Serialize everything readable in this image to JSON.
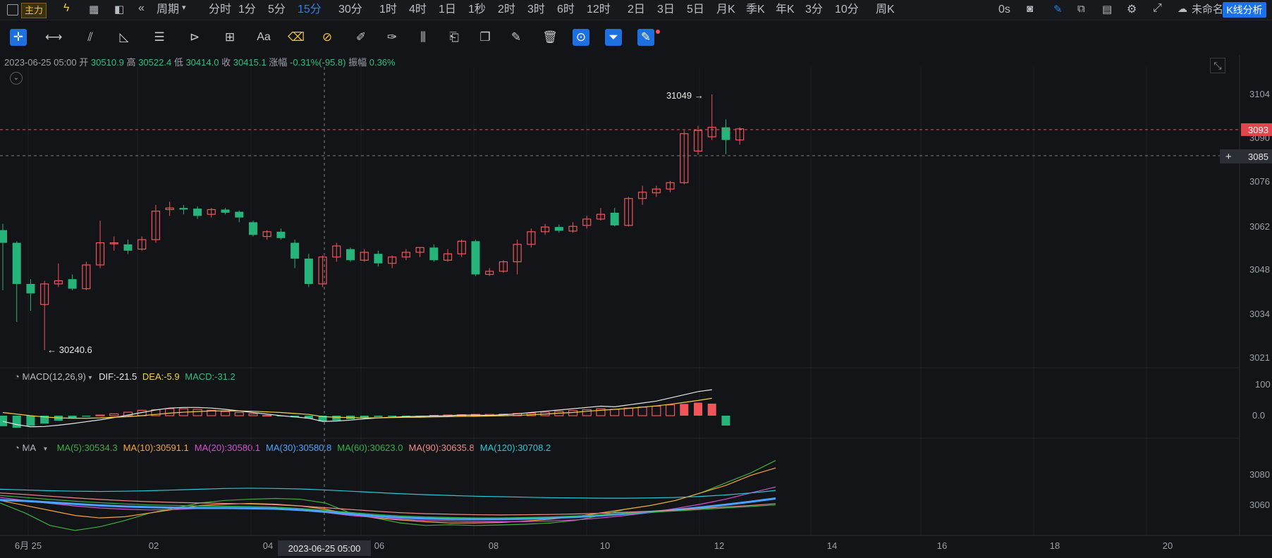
{
  "topbar": {
    "main_label": "主力",
    "period_label": "周期",
    "timeframes": [
      "分时",
      "1分",
      "5分",
      "15分",
      "30分",
      "1时",
      "4时",
      "1日",
      "1秒",
      "2时",
      "3时",
      "6时",
      "12时",
      "2日",
      "3日",
      "5日",
      "月K",
      "季K",
      "年K",
      "3分",
      "10分",
      "周K"
    ],
    "active_timeframe": "15分",
    "timer": "0s",
    "chart_name": "未命名",
    "analysis_button": "K线分析"
  },
  "toolbar": {
    "icons": [
      "crosshair-icon",
      "horizontal-line-icon",
      "trend-lines-icon",
      "angle-icon",
      "parallel-lines-icon",
      "fib-icon",
      "measure-icon",
      "text-icon",
      "eraser-icon",
      "magnet-icon",
      "ruler-icon",
      "brush-icon",
      "candles-icon",
      "clipboard-icon",
      "copy-icon",
      "edit-icon",
      "delete-icon",
      "lock-icon",
      "filter-icon",
      "drawing-settings-icon"
    ],
    "text_tool_label": "Aa"
  },
  "ohlc": {
    "date": "2023-06-25 05:00",
    "open_label": "开",
    "open": "30510.9",
    "high_label": "高",
    "high": "30522.4",
    "low_label": "低",
    "low": "30414.0",
    "close_label": "收",
    "close": "30415.1",
    "change_label": "涨幅",
    "change": "-0.31%(-95.8)",
    "amplitude_label": "振幅",
    "amplitude": "0.36%"
  },
  "macd_legend": {
    "name": "MACD(12,26,9)",
    "dif": "DIF:-21.5",
    "dea": "DEA:-5.9",
    "macd": "MACD:-31.2"
  },
  "ma_legend": {
    "name": "MA",
    "items": [
      {
        "text": "MA(5):30534.3",
        "color": "#3fae3f"
      },
      {
        "text": "MA(10):30591.1",
        "color": "#f5a43a"
      },
      {
        "text": "MA(20):30580.1",
        "color": "#d84fd1"
      },
      {
        "text": "MA(30):30580.8",
        "color": "#4aa3ff"
      },
      {
        "text": "MA(60):30623.0",
        "color": "#33b24a"
      },
      {
        "text": "MA(90):30635.8",
        "color": "#f08a8a"
      },
      {
        "text": "MA(120):30708.2",
        "color": "#27c9d6"
      }
    ]
  },
  "price_axis": {
    "labels": [
      "3104",
      "3090",
      "3076",
      "3062",
      "3048",
      "3034",
      "3021"
    ],
    "current_price": "3093",
    "crosshair_price": "3085"
  },
  "macd_axis": {
    "labels": [
      "100",
      "0.0"
    ]
  },
  "ma_axis": {
    "labels": [
      "3080",
      "3060"
    ]
  },
  "time_axis": {
    "labels": [
      "6月 25",
      "02",
      "04",
      "06",
      "08",
      "10",
      "12",
      "14",
      "16",
      "18",
      "20"
    ],
    "crosshair_label": "2023-06-25 05:00"
  },
  "annotations": {
    "high": "31049 →",
    "low": "← 30240.6"
  },
  "colors": {
    "up": "#f0555a",
    "down": "#26b47a",
    "accent": "#2f80ed",
    "background": "#131417"
  },
  "chart_data": [
    {
      "type": "candlestick",
      "title": "",
      "ylim": [
        30200,
        31100
      ],
      "high_marker": 31049,
      "low_marker": 30240.6,
      "candles": [
        {
          "o": 30620,
          "h": 30640,
          "l": 30430,
          "c": 30580
        },
        {
          "o": 30580,
          "h": 30585,
          "l": 30330,
          "c": 30450
        },
        {
          "o": 30450,
          "h": 30465,
          "l": 30365,
          "c": 30420
        },
        {
          "o": 30385,
          "h": 30460,
          "l": 30240.6,
          "c": 30450
        },
        {
          "o": 30450,
          "h": 30515,
          "l": 30440,
          "c": 30460
        },
        {
          "o": 30465,
          "h": 30480,
          "l": 30430,
          "c": 30435
        },
        {
          "o": 30435,
          "h": 30520,
          "l": 30430,
          "c": 30510
        },
        {
          "o": 30510,
          "h": 30650,
          "l": 30500,
          "c": 30580
        },
        {
          "o": 30580,
          "h": 30600,
          "l": 30555,
          "c": 30580
        },
        {
          "o": 30575,
          "h": 30590,
          "l": 30545,
          "c": 30555
        },
        {
          "o": 30560,
          "h": 30600,
          "l": 30555,
          "c": 30590
        },
        {
          "o": 30590,
          "h": 30700,
          "l": 30580,
          "c": 30680
        },
        {
          "o": 30685,
          "h": 30710,
          "l": 30665,
          "c": 30690
        },
        {
          "o": 30690,
          "h": 30700,
          "l": 30670,
          "c": 30685
        },
        {
          "o": 30688,
          "h": 30695,
          "l": 30655,
          "c": 30665
        },
        {
          "o": 30670,
          "h": 30690,
          "l": 30660,
          "c": 30685
        },
        {
          "o": 30685,
          "h": 30690,
          "l": 30670,
          "c": 30675
        },
        {
          "o": 30678,
          "h": 30682,
          "l": 30645,
          "c": 30660
        },
        {
          "o": 30645,
          "h": 30650,
          "l": 30600,
          "c": 30605
        },
        {
          "o": 30600,
          "h": 30620,
          "l": 30590,
          "c": 30615
        },
        {
          "o": 30615,
          "h": 30625,
          "l": 30590,
          "c": 30595
        },
        {
          "o": 30580,
          "h": 30590,
          "l": 30500,
          "c": 30530
        },
        {
          "o": 30530,
          "h": 30545,
          "l": 30440,
          "c": 30450
        },
        {
          "o": 30450,
          "h": 30540,
          "l": 30440,
          "c": 30535
        },
        {
          "o": 30535,
          "h": 30580,
          "l": 30520,
          "c": 30570
        },
        {
          "o": 30560,
          "h": 30565,
          "l": 30520,
          "c": 30525
        },
        {
          "o": 30525,
          "h": 30560,
          "l": 30520,
          "c": 30550
        },
        {
          "o": 30545,
          "h": 30555,
          "l": 30505,
          "c": 30515
        },
        {
          "o": 30515,
          "h": 30540,
          "l": 30500,
          "c": 30535
        },
        {
          "o": 30535,
          "h": 30560,
          "l": 30525,
          "c": 30550
        },
        {
          "o": 30550,
          "h": 30565,
          "l": 30535,
          "c": 30565
        },
        {
          "o": 30565,
          "h": 30575,
          "l": 30520,
          "c": 30525
        },
        {
          "o": 30525,
          "h": 30560,
          "l": 30520,
          "c": 30545
        },
        {
          "o": 30545,
          "h": 30590,
          "l": 30535,
          "c": 30585
        },
        {
          "o": 30585,
          "h": 30590,
          "l": 30475,
          "c": 30480
        },
        {
          "o": 30480,
          "h": 30500,
          "l": 30475,
          "c": 30490
        },
        {
          "o": 30490,
          "h": 30525,
          "l": 30485,
          "c": 30520
        },
        {
          "o": 30520,
          "h": 30590,
          "l": 30480,
          "c": 30575
        },
        {
          "o": 30575,
          "h": 30625,
          "l": 30565,
          "c": 30615
        },
        {
          "o": 30615,
          "h": 30640,
          "l": 30605,
          "c": 30630
        },
        {
          "o": 30630,
          "h": 30638,
          "l": 30612,
          "c": 30618
        },
        {
          "o": 30617,
          "h": 30645,
          "l": 30612,
          "c": 30632
        },
        {
          "o": 30635,
          "h": 30665,
          "l": 30625,
          "c": 30655
        },
        {
          "o": 30655,
          "h": 30690,
          "l": 30650,
          "c": 30670
        },
        {
          "o": 30675,
          "h": 30690,
          "l": 30632,
          "c": 30635
        },
        {
          "o": 30635,
          "h": 30725,
          "l": 30632,
          "c": 30720
        },
        {
          "o": 30720,
          "h": 30760,
          "l": 30700,
          "c": 30740
        },
        {
          "o": 30738,
          "h": 30760,
          "l": 30725,
          "c": 30750
        },
        {
          "o": 30750,
          "h": 30775,
          "l": 30740,
          "c": 30770
        },
        {
          "o": 30770,
          "h": 30935,
          "l": 30765,
          "c": 30925
        },
        {
          "o": 30870,
          "h": 30950,
          "l": 30858,
          "c": 30935
        },
        {
          "o": 30915,
          "h": 31049,
          "l": 30905,
          "c": 30945
        },
        {
          "o": 30945,
          "h": 30970,
          "l": 30860,
          "c": 30905
        },
        {
          "o": 30905,
          "h": 30945,
          "l": 30890,
          "c": 30940
        }
      ]
    },
    {
      "type": "bar",
      "title": "MACD(12,26,9)",
      "ylim": [
        -40,
        100
      ],
      "values": [
        -33,
        -38,
        -32,
        -25,
        -16,
        -9,
        -3,
        2,
        6,
        11,
        17,
        19,
        22,
        22,
        20,
        17,
        13,
        10,
        6,
        1,
        -2,
        -5,
        -9,
        -18,
        -15,
        -11,
        -7,
        -4,
        -3,
        -2,
        -1,
        1,
        2,
        3,
        4,
        4,
        5,
        7,
        8,
        11,
        14,
        16,
        19,
        22,
        20,
        24,
        27,
        30,
        34,
        37,
        41,
        38,
        -31.2
      ],
      "dif": [
        -18,
        -28,
        -35,
        -34,
        -30,
        -25,
        -19,
        -13,
        -6,
        2,
        10,
        18,
        24,
        26,
        26,
        24,
        20,
        15,
        10,
        5,
        0,
        -4,
        -8,
        -18,
        -17,
        -14,
        -10,
        -7,
        -5,
        -3,
        -2,
        -1,
        0,
        2,
        2,
        1,
        3,
        6,
        10,
        14,
        18,
        22,
        26,
        30,
        28,
        34,
        40,
        46,
        56,
        66,
        76,
        82,
        -21.5
      ],
      "dea": [
        10,
        5,
        0,
        -4,
        -7,
        -8,
        -8,
        -7,
        -5,
        -3,
        0,
        4,
        8,
        11,
        13,
        15,
        15,
        15,
        14,
        12,
        10,
        7,
        4,
        -3,
        -5,
        -6,
        -7,
        -7,
        -6,
        -5,
        -5,
        -4,
        -3,
        -2,
        -2,
        -1,
        0,
        1,
        3,
        5,
        8,
        10,
        14,
        17,
        20,
        23,
        27,
        31,
        36,
        42,
        48,
        55,
        -5.9
      ]
    },
    {
      "type": "line",
      "title": "MA",
      "ylim": [
        30520,
        30830
      ],
      "series": [
        {
          "name": "MA(5)",
          "color": "#3fae3f",
          "values": [
            30650,
            30610,
            30560,
            30540,
            30555,
            30580,
            30610,
            30630,
            30650,
            30660,
            30665,
            30668,
            30665,
            30650,
            30610,
            30590,
            30570,
            30560,
            30563,
            30560,
            30562,
            30565,
            30570,
            30580,
            30600,
            30625,
            30640,
            30660,
            30690,
            30730,
            30770,
            30820
          ]
        },
        {
          "name": "MA(10)",
          "color": "#f5a43a",
          "values": [
            30660,
            30640,
            30620,
            30600,
            30590,
            30595,
            30610,
            30625,
            30640,
            30645,
            30648,
            30645,
            30638,
            30625,
            30605,
            30590,
            30582,
            30575,
            30570,
            30570,
            30572,
            30578,
            30585,
            30595,
            30610,
            30625,
            30640,
            30660,
            30690,
            30720,
            30760,
            30790
          ]
        },
        {
          "name": "MA(20)",
          "color": "#d84fd1",
          "values": [
            30672,
            30660,
            30648,
            30638,
            30630,
            30625,
            30622,
            30624,
            30628,
            30630,
            30630,
            30628,
            30620,
            30612,
            30600,
            30592,
            30585,
            30580,
            30578,
            30576,
            30575,
            30576,
            30578,
            30582,
            30590,
            30600,
            30612,
            30628,
            30645,
            30665,
            30690,
            30714
          ]
        },
        {
          "name": "MA(30)",
          "color": "#4aa3ff",
          "values": [
            30662,
            30658,
            30652,
            30646,
            30640,
            30636,
            30633,
            30631,
            30630,
            30630,
            30629,
            30627,
            30622,
            30615,
            30606,
            30598,
            30592,
            30588,
            30586,
            30585,
            30585,
            30587,
            30590,
            30594,
            30600,
            30607,
            30614,
            30622,
            30632,
            30643,
            30655,
            30668
          ]
        },
        {
          "name": "MA(60)",
          "color": "#33b24a",
          "values": [
            30680,
            30672,
            30664,
            30657,
            30651,
            30646,
            30642,
            30640,
            30638,
            30637,
            30636,
            30633,
            30628,
            30620,
            30612,
            30604,
            30598,
            30594,
            30592,
            30590,
            30590,
            30592,
            30594,
            30598,
            30603,
            30608,
            30613,
            30618,
            30624,
            30630,
            30636,
            30642
          ]
        },
        {
          "name": "MA(90)",
          "color": "#f08a8a",
          "values": [
            30690,
            30684,
            30677,
            30670,
            30664,
            30659,
            30655,
            30652,
            30650,
            30648,
            30646,
            30643,
            30638,
            30631,
            30624,
            30617,
            30611,
            30607,
            30605,
            30603,
            30602,
            30603,
            30604,
            30606,
            30609,
            30613,
            30617,
            30622,
            30628,
            30634,
            30640,
            30647
          ]
        },
        {
          "name": "MA(120)",
          "color": "#27c9d6",
          "values": [
            30705,
            30702,
            30699,
            30697,
            30696,
            30697,
            30699,
            30702,
            30705,
            30708,
            30709,
            30708,
            30706,
            30702,
            30697,
            30692,
            30687,
            30683,
            30680,
            30677,
            30675,
            30673,
            30671,
            30670,
            30669,
            30669,
            30670,
            30672,
            30676,
            30682,
            30690,
            30700
          ]
        }
      ]
    }
  ]
}
